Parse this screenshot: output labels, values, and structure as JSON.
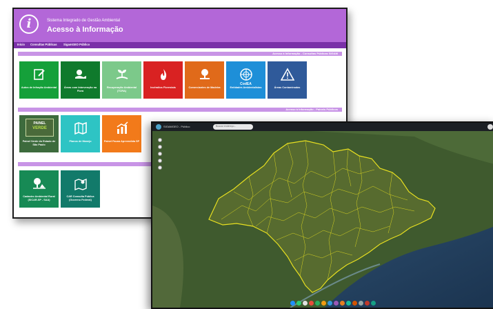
{
  "portal": {
    "system_name": "Sistema Integrado de Gestão Ambiental",
    "page_title": "Acesso à Informação",
    "logo_glyph": "i",
    "nav": [
      "Início",
      "Consultas Públicas",
      "SigamGEO Público"
    ],
    "section1_title": "Acesso à Informação - Consultas Públicas SIGAM",
    "section2_title": "Acesso à Informação - Paineis Públicos",
    "tiles_row1": [
      {
        "label": "Autos de Infração Ambiental",
        "color": "#15a03a",
        "icon": "document-edit-icon"
      },
      {
        "label": "Áreas com Intervenção na Flora",
        "color": "#0f7a2c",
        "icon": "hand-leaf-icon"
      },
      {
        "label": "Recuperação Ambiental (TCRA)",
        "color": "#7cc98a",
        "icon": "sprout-hand-icon"
      },
      {
        "label": "Incêndios Florestais",
        "color": "#d92222",
        "icon": "fire-icon"
      },
      {
        "label": "Comerciantes de Madeira",
        "color": "#e06a1a",
        "icon": "tree-hand-icon"
      },
      {
        "label": "Entidades Ambientalistas",
        "color": "#1e8fd8",
        "icon": "codea-globe-icon"
      },
      {
        "label": "Áreas Contaminadas",
        "color": "#2f5a9a",
        "icon": "warning-triangle-icon"
      }
    ],
    "codea_text": "CodEA",
    "tiles_row2": [
      {
        "label": "Painel Verde do Estado de São Paulo",
        "color": "#3d6b3d",
        "icon": "painel-verde-logo"
      },
      {
        "label": "Planos de Manejo",
        "color": "#2ec4c4",
        "icon": "map-fold-icon"
      },
      {
        "label": "Painel Fauna Apreendida SP",
        "color": "#f27a1a",
        "icon": "bar-chart-icon"
      }
    ],
    "painel_logo_line1": "PAINEL",
    "painel_logo_line2": "VERDE",
    "tiles_row3": [
      {
        "label": "Cadastro Ambiental Rural (SICAR-SP - SAA)",
        "color": "#178a55",
        "icon": "farm-tree-icon"
      },
      {
        "label": "CAR Consulta Pública (Governo Federal)",
        "color": "#127a6a",
        "icon": "map-pin-icon"
      }
    ]
  },
  "map": {
    "app_title": "SIGAMGEO - Público",
    "search_placeholder": "Buscar endereço...",
    "bottom_dot_colors": [
      "#1e90ff",
      "#2ecc71",
      "#e0e0e0",
      "#e74c3c",
      "#27ae60",
      "#f39c12",
      "#3498db",
      "#9b59b6",
      "#e67e22",
      "#1abc9c",
      "#d35400",
      "#95a5a6",
      "#c0392b",
      "#16a085"
    ]
  }
}
